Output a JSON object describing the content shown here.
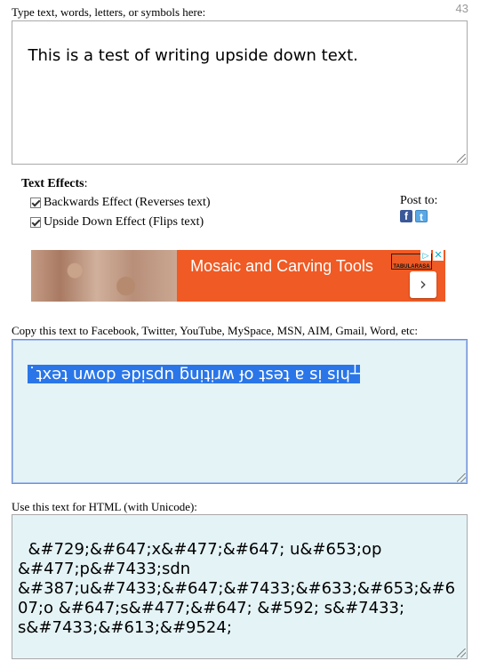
{
  "counter": "43",
  "input": {
    "label": "Type text, words, letters, or symbols here:",
    "value": "This is a test of writing upside down text."
  },
  "effects": {
    "title": "Text Effects",
    "title_suffix": ":",
    "backwards": {
      "label": "Backwards Effect (Reverses text)",
      "checked": true
    },
    "upside_down": {
      "label": "Upside Down Effect (Flips text)",
      "checked": true
    }
  },
  "post_to": {
    "label": "Post to:",
    "facebook_icon": "f",
    "twitter_icon": "t"
  },
  "ad": {
    "text": "Mosaic and Carving Tools",
    "brand": "TABULARASA",
    "adchoices": "▷",
    "close": "✕",
    "arrow": "›"
  },
  "copy_output": {
    "label": "Copy this text to Facebook, Twitter, YouTube, MySpace, MSN, AIM, Gmail, Word, etc:",
    "value": "˙ʇxǝʇ uʍop ǝpᴉsdn ƃuᴉʇᴉɹʍ ɟo ʇsǝʇ ɐ sᴉ sᴉɥ┴"
  },
  "html_output": {
    "label": "Use this text for HTML (with Unicode):",
    "value": "&#729;&#647;x&#477;&#647; u&#653;op &#477;p&#7433;sdn &#387;u&#7433;&#647;&#7433;&#633;&#653;&#607;o &#647;s&#477;&#647; &#592; s&#7433; s&#7433;&#613;&#9524;"
  },
  "colors": {
    "output_bg": "#e4f3f6",
    "selection": "#2a76e8",
    "ad_bg": "#f05a24",
    "facebook": "#3b5998",
    "twitter": "#5aa9e6"
  }
}
